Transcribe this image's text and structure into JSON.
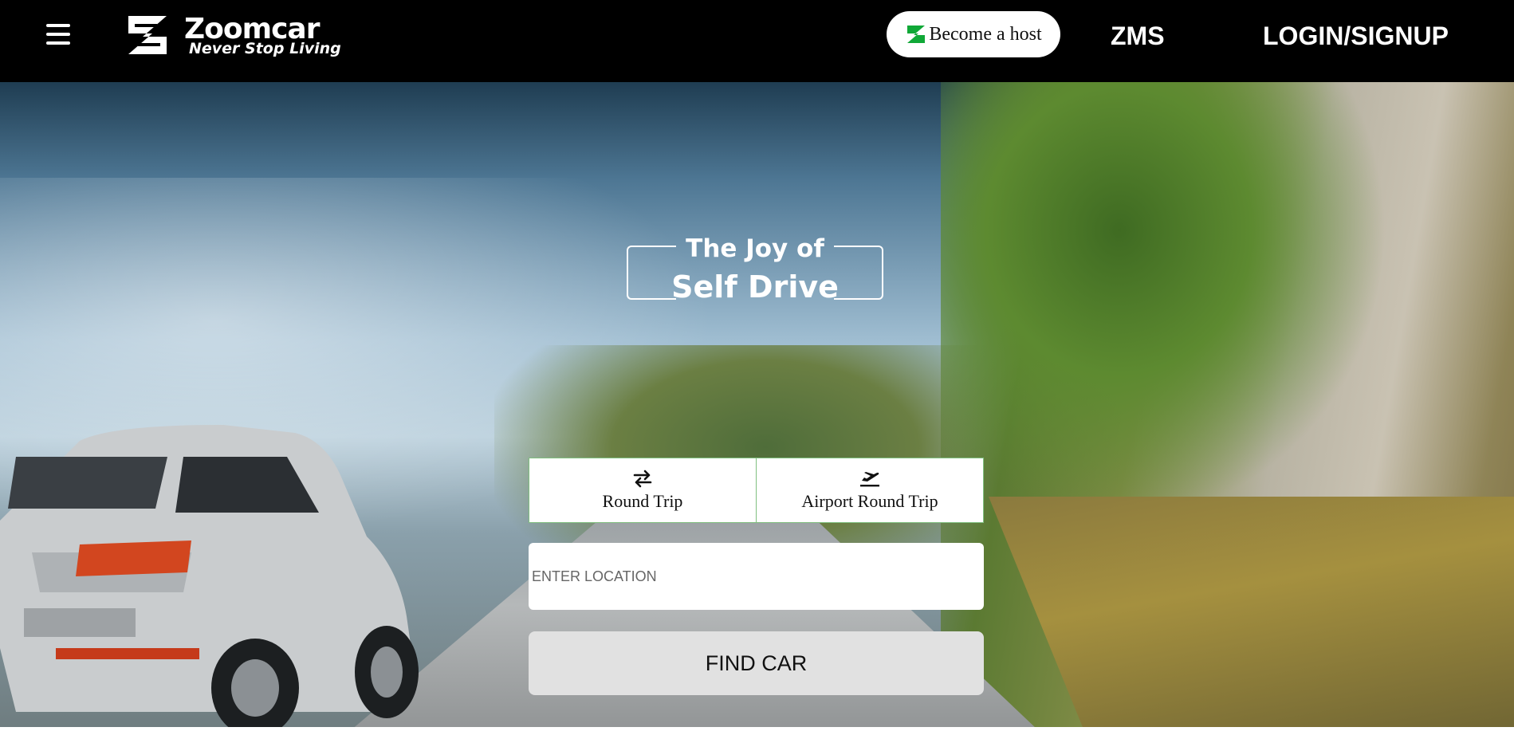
{
  "header": {
    "menu_icon": "hamburger-menu-icon",
    "logo_name": "Zoomcar",
    "logo_tagline": "Never Stop Living",
    "host_button_label": "Become a host",
    "zms_label": "ZMS",
    "login_label": "LOGIN/SIGNUP"
  },
  "hero": {
    "tagline_line1": "The Joy of",
    "tagline_line2": "Self Drive"
  },
  "trip_tabs": [
    {
      "label": "Round Trip",
      "icon": "swap-arrows-icon"
    },
    {
      "label": "Airport Round Trip",
      "icon": "airplane-takeoff-icon"
    }
  ],
  "search": {
    "location_placeholder": "ENTER LOCATION",
    "location_value": "",
    "find_label": "FIND CAR"
  },
  "colors": {
    "topbar": "#000000",
    "brand_green": "#10a837",
    "tab_border": "#7fbf7f",
    "find_button": "#e1e1e1"
  }
}
